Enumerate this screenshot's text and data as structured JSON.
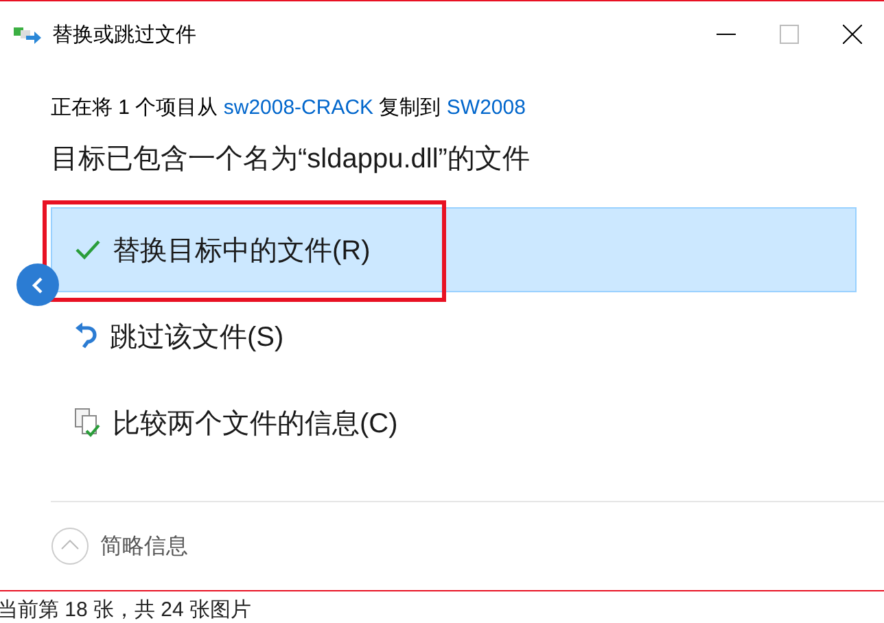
{
  "window": {
    "title": "替换或跳过文件"
  },
  "copy_line": [
    {
      "kind": "text",
      "text": "正在将 1 个项目从 "
    },
    {
      "kind": "link",
      "text": "sw2008-CRACK"
    },
    {
      "kind": "text",
      "text": " 复制到 "
    },
    {
      "kind": "link",
      "text": "SW2008"
    }
  ],
  "heading": "目标已包含一个名为“sldappu.dll”的文件",
  "options": [
    {
      "kind": "replace",
      "label": "替换目标中的文件(R)",
      "selected": true,
      "outlined": true
    },
    {
      "kind": "skip",
      "label": "跳过该文件(S)",
      "selected": false,
      "outlined": false
    },
    {
      "kind": "compare",
      "label": "比较两个文件的信息(C)",
      "selected": false,
      "outlined": false
    }
  ],
  "details_toggle": {
    "label": "简略信息",
    "expanded": true
  },
  "viewer_caption": "当前第 18 张，共 24 张图片"
}
